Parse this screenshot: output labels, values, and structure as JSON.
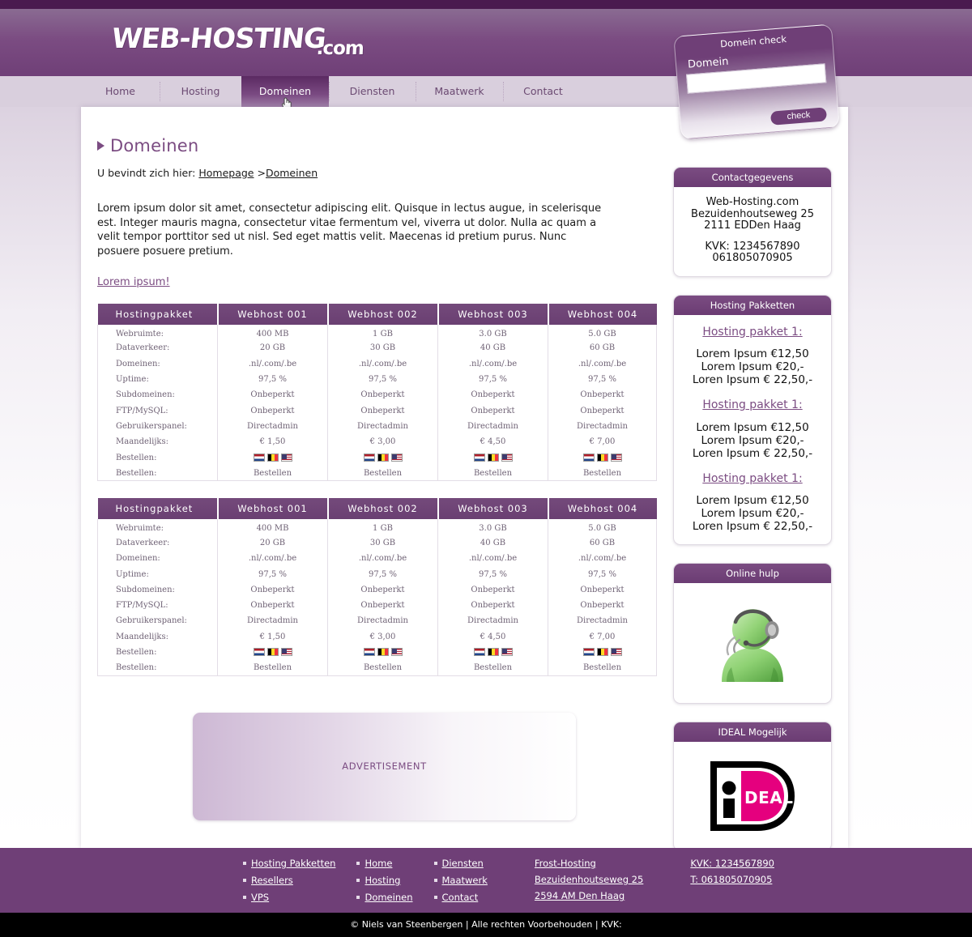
{
  "brand": {
    "logo_main": "WEB-HOSTING",
    "logo_suffix": ".com"
  },
  "nav": {
    "items": [
      {
        "label": "Home",
        "active": false
      },
      {
        "label": "Hosting",
        "active": false
      },
      {
        "label": "Domeinen",
        "active": true
      },
      {
        "label": "Diensten",
        "active": false
      },
      {
        "label": "Maatwerk",
        "active": false
      },
      {
        "label": "Contact",
        "active": false
      }
    ]
  },
  "domain_check": {
    "title": "Domein check",
    "field_label": "Domein",
    "input_value": "",
    "input_placeholder": "",
    "button_label": "check"
  },
  "main": {
    "page_title": "Domeinen",
    "breadcrumb_prefix": "U bevindt zich hier:",
    "breadcrumb_home": "Homepage",
    "breadcrumb_sep": ">",
    "breadcrumb_current": "Domeinen",
    "intro_paragraph": "Lorem ipsum dolor sit amet, consectetur adipiscing elit. Quisque in lectus augue, in scelerisque est. Integer mauris magna, consectetur vitae fermentum vel, viverra ut dolor. Nulla ac quam a velit tempor porttitor sed ut nisl. Sed eget mattis velit. Maecenas id pretium purus. Nunc posuere posuere pretium.",
    "intro_link": "Lorem ipsum!",
    "advertisement_label": "ADVERTISEMENT"
  },
  "pricing_table": {
    "headers": [
      "Hostingpakket",
      "Webhost 001",
      "Webhost 002",
      "Webhost 003",
      "Webhost 004"
    ],
    "rows": [
      {
        "label": "Webruimte:",
        "values": [
          "400 MB",
          "1 GB",
          "3.0 GB",
          "5.0 GB"
        ]
      },
      {
        "label": "Dataverkeer:",
        "values": [
          "20 GB",
          "30 GB",
          "40 GB",
          "60 GB"
        ]
      },
      {
        "label": "Domeinen:",
        "values": [
          ".nl/.com/.be",
          ".nl/.com/.be",
          ".nl/.com/.be",
          ".nl/.com/.be"
        ]
      },
      {
        "label": "Uptime:",
        "values": [
          "97,5 %",
          "97,5 %",
          "97,5 %",
          "97,5 %"
        ]
      },
      {
        "label": "Subdomeinen:",
        "values": [
          "Onbeperkt",
          "Onbeperkt",
          "Onbeperkt",
          "Onbeperkt"
        ]
      },
      {
        "label": "FTP/MySQL:",
        "values": [
          "Onbeperkt",
          "Onbeperkt",
          "Onbeperkt",
          "Onbeperkt"
        ]
      },
      {
        "label": "Gebruikerspanel:",
        "values": [
          "Directadmin",
          "Directadmin",
          "Directadmin",
          "Directadmin"
        ]
      },
      {
        "label": "Maandelijks:",
        "values": [
          "€ 1,50",
          "€ 3,00",
          "€ 4,50",
          "€ 7,00"
        ]
      },
      {
        "label": "Bestellen:",
        "flags": [
          "flag-nl",
          "flag-be",
          "flag-us"
        ]
      },
      {
        "label": "Bestellen:",
        "values": [
          "Bestellen",
          "Bestellen",
          "Bestellen",
          "Bestellen"
        ]
      }
    ]
  },
  "sidebar": {
    "contact": {
      "title": "Contactgegevens",
      "company": "Web-Hosting.com",
      "street": "Bezuidenhoutseweg 25",
      "city": "2111 EDDen Haag",
      "kvk": "KVK: 1234567890",
      "phone": "061805070905"
    },
    "packages": {
      "title": "Hosting Pakketten",
      "items": [
        {
          "link": "Hosting pakket 1:",
          "price1": "Lorem Ipsum €12,50",
          "price2": "Lorem Ipsum €20,-",
          "price3": "Loren Ipsum € 22,50,-"
        },
        {
          "link": "Hosting pakket 1:",
          "price1": "Lorem Ipsum €12,50",
          "price2": "Lorem Ipsum €20,-",
          "price3": "Loren Ipsum € 22,50,-"
        },
        {
          "link": "Hosting pakket 1:",
          "price1": "Lorem Ipsum €12,50",
          "price2": "Lorem Ipsum €20,-",
          "price3": "Loren Ipsum € 22,50,-"
        }
      ]
    },
    "online_help": {
      "title": "Online hulp",
      "icon": "headset-person-icon"
    },
    "ideal": {
      "title": "IDEAL Mogelijk",
      "logo_text": "iDEAL"
    }
  },
  "footer": {
    "col1": [
      "Hosting Pakketten",
      "Resellers",
      "VPS"
    ],
    "col2": [
      "Home",
      "Hosting",
      "Domeinen"
    ],
    "col3": [
      "Diensten",
      "Maatwerk",
      "Contact"
    ],
    "address": [
      "Frost-Hosting",
      "Bezuidenhoutseweg 25",
      "2594 AM Den Haag"
    ],
    "contact": [
      "KVK: 1234567890",
      "T: 061805070905"
    ],
    "copyright": "© Niels van Steenbergen | Alle rechten Voorbehouden | KVK:"
  },
  "colors": {
    "brand_purple": "#6f3f77",
    "dark_purple": "#4a1a4f",
    "nav_bg": "#d9cfdd",
    "ideal_pink": "#e5007e"
  }
}
